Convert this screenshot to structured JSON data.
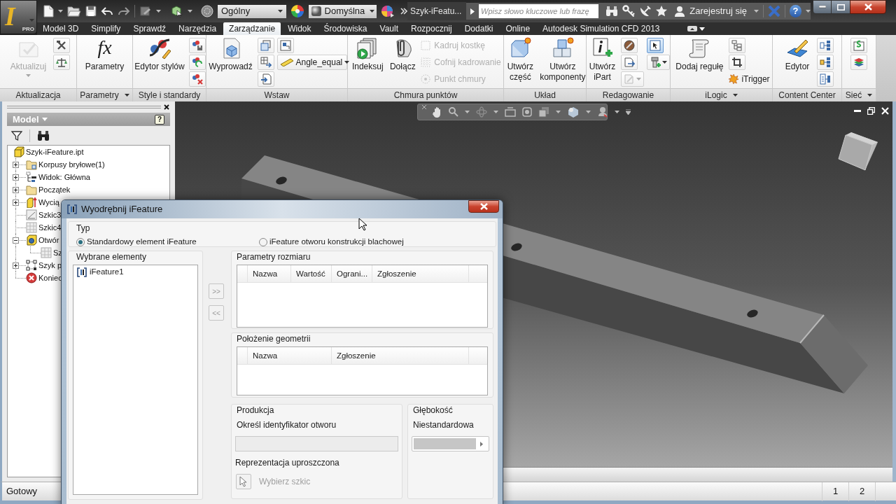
{
  "app_button": {
    "logo": "I",
    "edition": "PRO"
  },
  "quick_access": {
    "style_dropdown": "Ogólny",
    "appearance_dropdown": "Domyślna"
  },
  "document_title": "Szyk-iFeatu...",
  "search": {
    "placeholder": "Wpisz słowo kluczowe lub frazę"
  },
  "sign_in": "Zarejestruj się",
  "help": "?",
  "tabs": [
    {
      "label": "Model 3D",
      "selected": false
    },
    {
      "label": "Simplify",
      "selected": false
    },
    {
      "label": "Sprawdź",
      "selected": false
    },
    {
      "label": "Narzędzia",
      "selected": false
    },
    {
      "label": "Zarządzanie",
      "selected": true
    },
    {
      "label": "Widok",
      "selected": false
    },
    {
      "label": "Środowiska",
      "selected": false
    },
    {
      "label": "Vault",
      "selected": false
    },
    {
      "label": "Rozpocznij",
      "selected": false
    },
    {
      "label": "Dodatki",
      "selected": false
    },
    {
      "label": "Online",
      "selected": false
    },
    {
      "label": "Autodesk Simulation CFD 2013",
      "selected": false
    }
  ],
  "ribbon": {
    "panels": [
      {
        "title": "Aktualizacja",
        "menu": false,
        "tools": [
          {
            "label": "Aktualizuj",
            "disabled": true
          }
        ]
      },
      {
        "title": "Parametry",
        "menu": true,
        "tools": [
          {
            "label": "Parametry",
            "icon_text": "fx",
            "disabled": false
          }
        ]
      },
      {
        "title": "Style i standardy",
        "menu": false,
        "tools": [
          {
            "label": "Edytor stylów",
            "disabled": false
          }
        ]
      },
      {
        "title": "Wstaw",
        "menu": false,
        "tools": [
          {
            "label": "Wyprowadź",
            "disabled": false
          },
          {
            "label": "Angle_equal",
            "disabled": false
          }
        ]
      },
      {
        "title": "Chmura punktów",
        "menu": false,
        "tools": [
          {
            "label": "Indeksuj",
            "disabled": false
          },
          {
            "label": "Dołącz",
            "disabled": false
          },
          {
            "label": "Kadruj kostkę",
            "disabled": true
          },
          {
            "label": "Cofnij kadrowanie",
            "disabled": true
          },
          {
            "label": "Punkt chmury",
            "disabled": true
          }
        ]
      },
      {
        "title": "Układ",
        "menu": false,
        "tools": [
          {
            "label": "Utwórz część",
            "disabled": false
          },
          {
            "label": "Utwórz komponenty",
            "disabled": false
          }
        ]
      },
      {
        "title": "Redagowanie",
        "menu": false,
        "tools": [
          {
            "label": "Utwórz iPart",
            "disabled": false
          }
        ]
      },
      {
        "title": "iLogic",
        "menu": true,
        "tools": [
          {
            "label": "Dodaj regułę",
            "disabled": false
          },
          {
            "label": "iTrigger",
            "disabled": false
          }
        ]
      },
      {
        "title": "Content Center",
        "menu": false,
        "tools": [
          {
            "label": "Edytor",
            "disabled": false
          }
        ]
      },
      {
        "title": "Sieć",
        "menu": true
      }
    ]
  },
  "browser": {
    "title": "Model",
    "help": "?",
    "tree": [
      {
        "label": "Szyk-iFeature.ipt",
        "kind": "part",
        "children": [
          {
            "label": "Korpusy bryłowe(1)",
            "kind": "bodies",
            "expanded": false
          },
          {
            "label": "Widok: Główna",
            "kind": "view",
            "expanded": false
          },
          {
            "label": "Początek",
            "kind": "origin",
            "expanded": false
          },
          {
            "label": "Wycią",
            "kind": "extrusion",
            "expanded": false
          },
          {
            "label": "Szkic3",
            "kind": "sketch"
          },
          {
            "label": "Szkic4",
            "kind": "shared_sketch"
          },
          {
            "label": "Otwór",
            "kind": "hole",
            "expanded": true,
            "children": [
              {
                "label": "Sz",
                "kind": "shared_sketch"
              }
            ]
          },
          {
            "label": "Szyk p",
            "kind": "pattern",
            "expanded": false
          },
          {
            "label": "Koniec",
            "kind": "end"
          }
        ]
      }
    ]
  },
  "dialog": {
    "title": "Wyodrębnij iFeature",
    "type_group": {
      "title": "Typ",
      "options": [
        {
          "label": "Standardowy element iFeature",
          "selected": true
        },
        {
          "label": "iFeature otworu konstrukcji blachowej",
          "selected": false
        }
      ]
    },
    "selected_items": {
      "title": "Wybrane elementy",
      "items": [
        {
          "label": "iFeature1"
        }
      ]
    },
    "move_buttons": [
      {
        "label": ">>",
        "disabled": true
      },
      {
        "label": "<<",
        "disabled": true
      }
    ],
    "size_parameters": {
      "title": "Parametry rozmiaru",
      "columns": [
        "Nazwa",
        "Wartość",
        "Ograni...",
        "Zgłoszenie"
      ]
    },
    "geometry_position": {
      "title": "Położenie geometrii",
      "columns": [
        "Nazwa",
        "Zgłoszenie"
      ]
    },
    "manufacturing": {
      "title": "Produkcja",
      "field_label": "Określ identyfikator otworu",
      "field": {
        "disabled": true
      },
      "simplified_label": "Reprezentacja uproszczona",
      "select_sketch": {
        "label": "Wybierz szkic",
        "disabled": true
      }
    },
    "depth": {
      "title": "Głębokość",
      "label": "Niestandardowa",
      "combo": {
        "disabled": true
      }
    }
  },
  "status_bar": {
    "text": "Gotowy",
    "cells": [
      "1",
      "2"
    ]
  }
}
